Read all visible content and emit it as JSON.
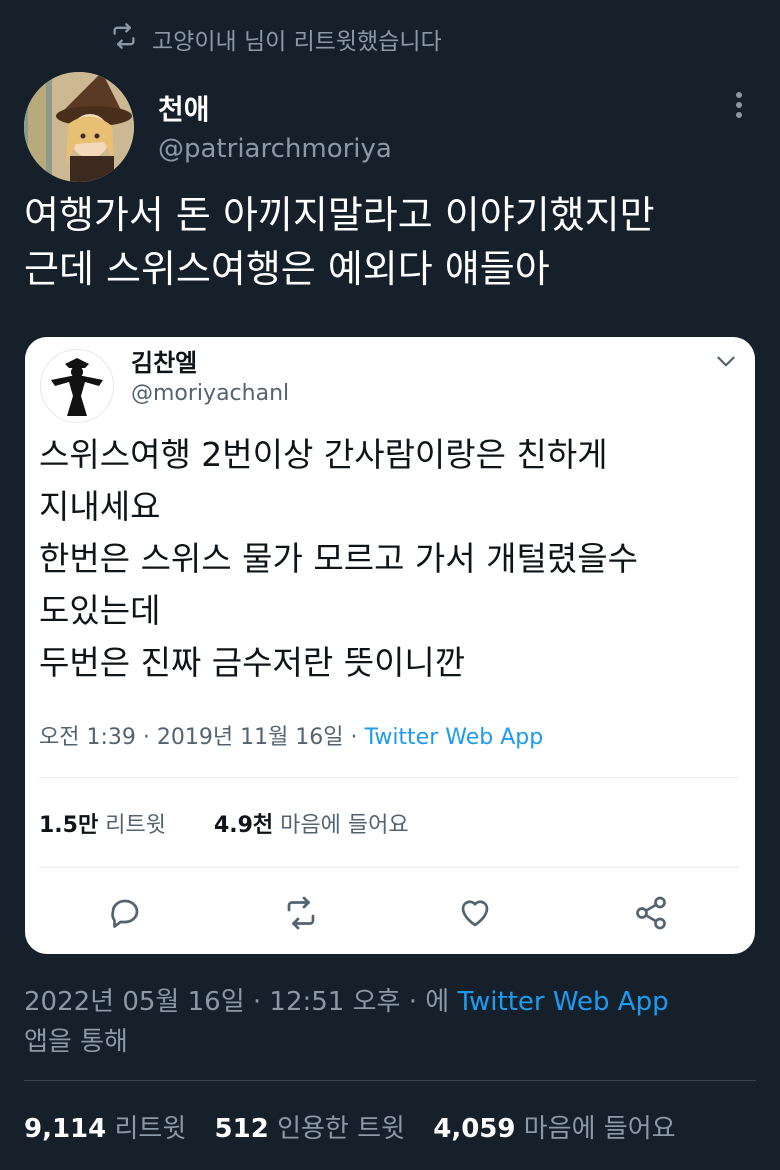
{
  "retweet_banner": {
    "text": "고양이내 님이 리트윗했습니다"
  },
  "tweet": {
    "display_name": "천애",
    "handle": "@patriarchmoriya",
    "text_lines": [
      "여행가서 돈 아끼지말라고 이야기했지만",
      "근데 스위스여행은 예외다 얘들아"
    ],
    "timestamp": "2022년 05월 16일 · 12:51 오후 · 에",
    "via_app": "Twitter Web App",
    "via_suffix": "앱을 통해",
    "retweets_count": "9,114",
    "retweets_label": "리트윗",
    "quotes_count": "512",
    "quotes_label": "인용한 트윗",
    "likes_count": "4,059",
    "likes_label": "마음에 들어요"
  },
  "quoted_tweet": {
    "display_name": "김찬엘",
    "handle": "@moriyachanl",
    "text_lines": [
      "스위스여행 2번이상 간사람이랑은 친하게",
      "지내세요",
      "한번은 스위스 물가 모르고 가서 개털렸을수",
      "도있는데",
      "두번은 진짜 금수저란 뜻이니깐"
    ],
    "timestamp": "오전 1:39 · 2019년 11월 16일 · ",
    "via_app": "Twitter Web App",
    "retweets_count": "1.5만",
    "retweets_label": "리트윗",
    "likes_count": "4.9천",
    "likes_label": "마음에 들어요"
  },
  "colors": {
    "background": "#15202b",
    "accent": "#1d9bf0",
    "muted": "#8b98a5"
  },
  "icons": [
    "retweet-icon",
    "more-icon",
    "chevron-down-icon",
    "reply-icon",
    "retweet-icon",
    "like-icon",
    "share-icon"
  ]
}
